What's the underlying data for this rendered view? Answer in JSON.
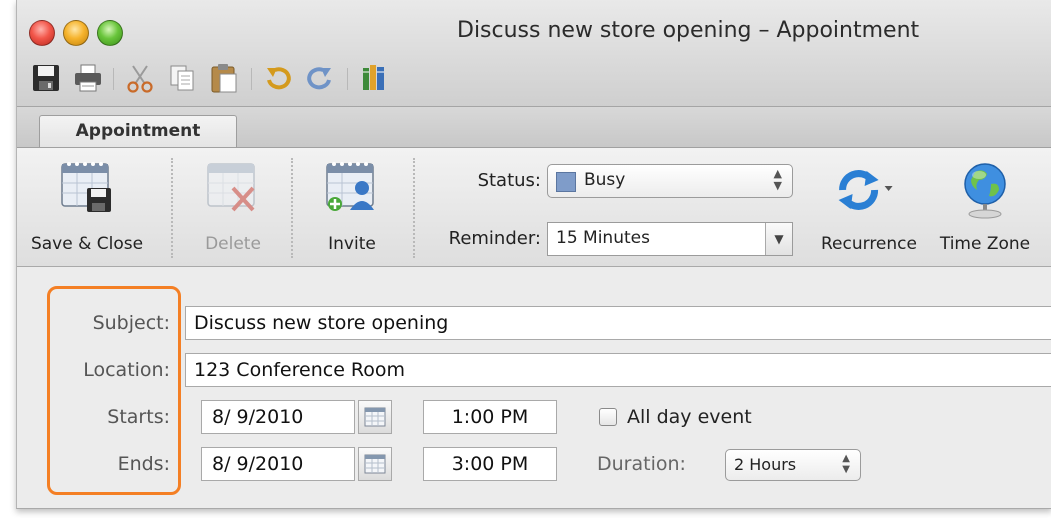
{
  "window": {
    "title": "Discuss new store opening – Appointment"
  },
  "toolbar_icons": [
    "save-icon",
    "print-icon",
    "cut-icon",
    "copy-icon",
    "paste-icon",
    "undo-icon",
    "redo-icon",
    "books-icon"
  ],
  "tabs": [
    {
      "label": "Appointment",
      "selected": true
    }
  ],
  "ribbon": {
    "save_close": "Save & Close",
    "delete": "Delete",
    "invite": "Invite",
    "status_label": "Status:",
    "status_value": "Busy",
    "status_swatch": "#7f9cc9",
    "reminder_label": "Reminder:",
    "reminder_value": "15 Minutes",
    "recurrence": "Recurrence",
    "time_zone": "Time Zone"
  },
  "form": {
    "subject_label": "Subject:",
    "subject_value": "Discuss new store opening",
    "location_label": "Location:",
    "location_value": "123 Conference Room",
    "starts_label": "Starts:",
    "start_date": "8/ 9/2010",
    "start_time": "1:00 PM",
    "all_day_label": "All day event",
    "all_day_checked": false,
    "ends_label": "Ends:",
    "end_date": "8/ 9/2010",
    "end_time": "3:00 PM",
    "duration_label": "Duration:",
    "duration_value": "2 Hours"
  },
  "colors": {
    "highlight": "#f47f24",
    "accent": "#2a7fd4"
  }
}
